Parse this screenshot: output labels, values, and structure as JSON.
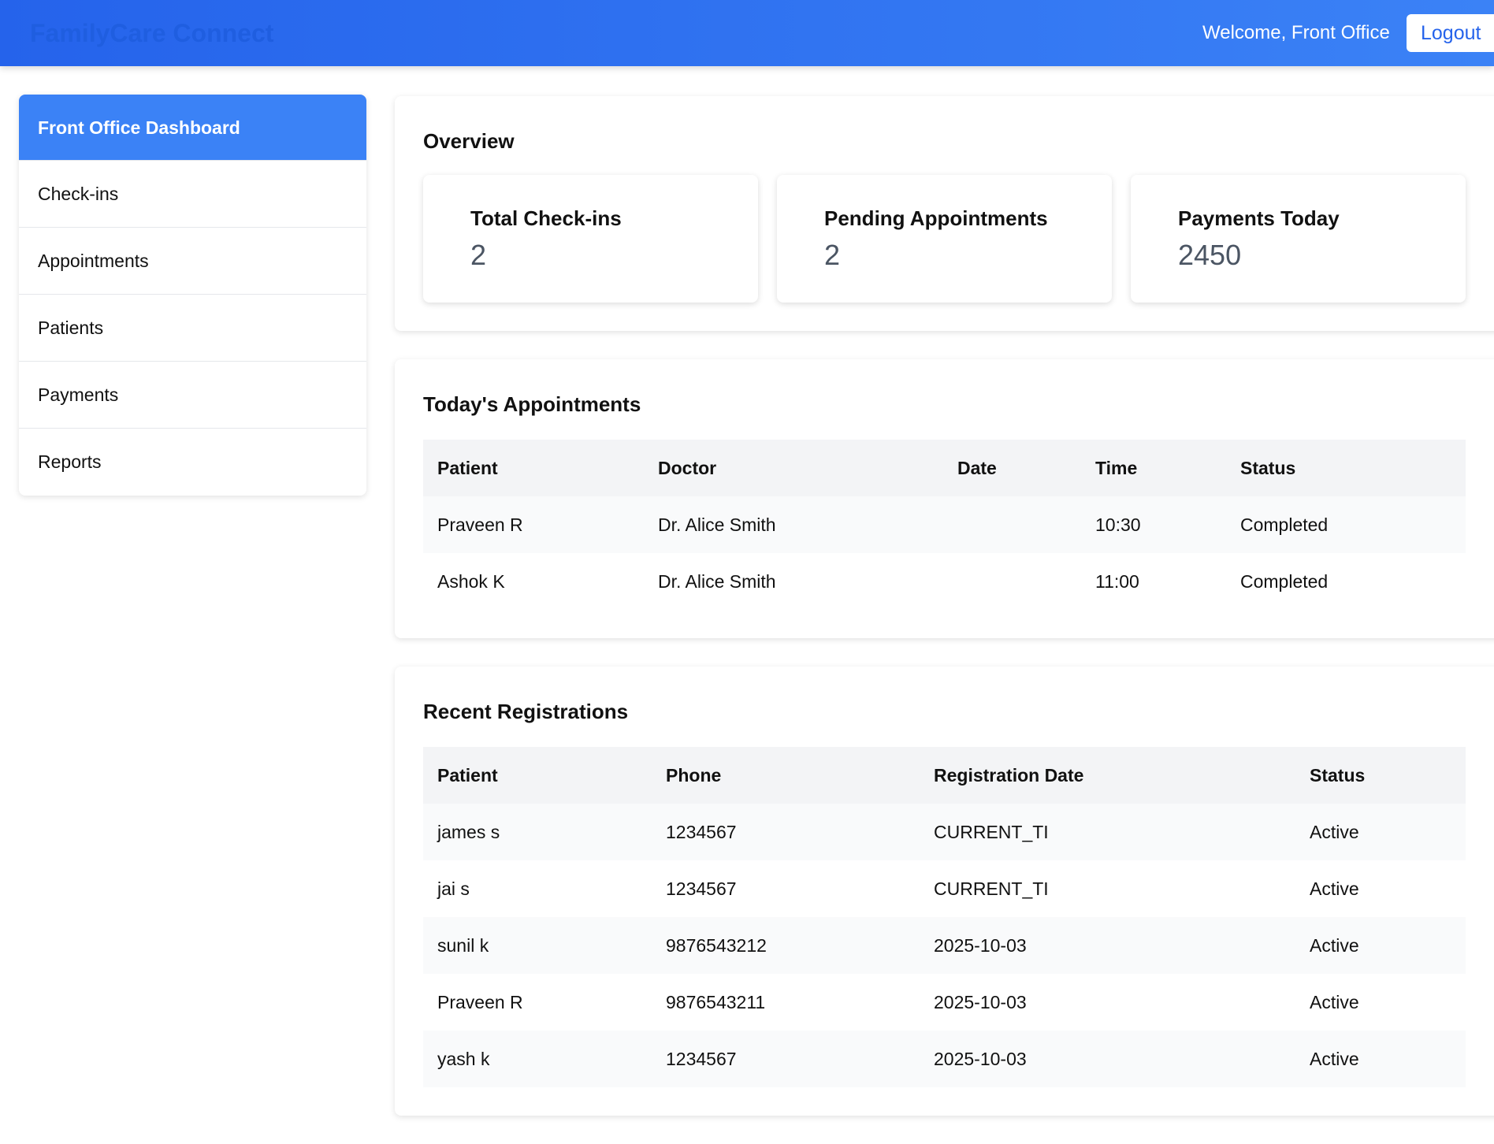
{
  "header": {
    "logo": "FamilyCare Connect",
    "welcome": "Welcome, Front Office",
    "logout": "Logout"
  },
  "sidebar": {
    "items": [
      {
        "label": "Front Office Dashboard"
      },
      {
        "label": "Check-ins"
      },
      {
        "label": "Appointments"
      },
      {
        "label": "Patients"
      },
      {
        "label": "Payments"
      },
      {
        "label": "Reports"
      }
    ]
  },
  "overview": {
    "title": "Overview",
    "stats": [
      {
        "label": "Total Check-ins",
        "value": "2"
      },
      {
        "label": "Pending Appointments",
        "value": "2"
      },
      {
        "label": "Payments Today",
        "value": "2450"
      }
    ]
  },
  "appointments": {
    "title": "Today's Appointments",
    "headers": [
      "Patient",
      "Doctor",
      "Date",
      "Time",
      "Status"
    ],
    "rows": [
      [
        "Praveen R",
        "Dr. Alice Smith",
        "",
        "10:30",
        "Completed"
      ],
      [
        "Ashok K",
        "Dr. Alice Smith",
        "",
        "11:00",
        "Completed"
      ]
    ]
  },
  "registrations": {
    "title": "Recent Registrations",
    "headers": [
      "Patient",
      "Phone",
      "Registration Date",
      "Status"
    ],
    "rows": [
      [
        "james s",
        "1234567",
        "CURRENT_TI",
        "Active"
      ],
      [
        "jai s",
        "1234567",
        "CURRENT_TI",
        "Active"
      ],
      [
        "sunil k",
        "9876543212",
        "2025-10-03",
        "Active"
      ],
      [
        "Praveen R",
        "9876543211",
        "2025-10-03",
        "Active"
      ],
      [
        "yash k",
        "1234567",
        "2025-10-03",
        "Active"
      ]
    ]
  }
}
